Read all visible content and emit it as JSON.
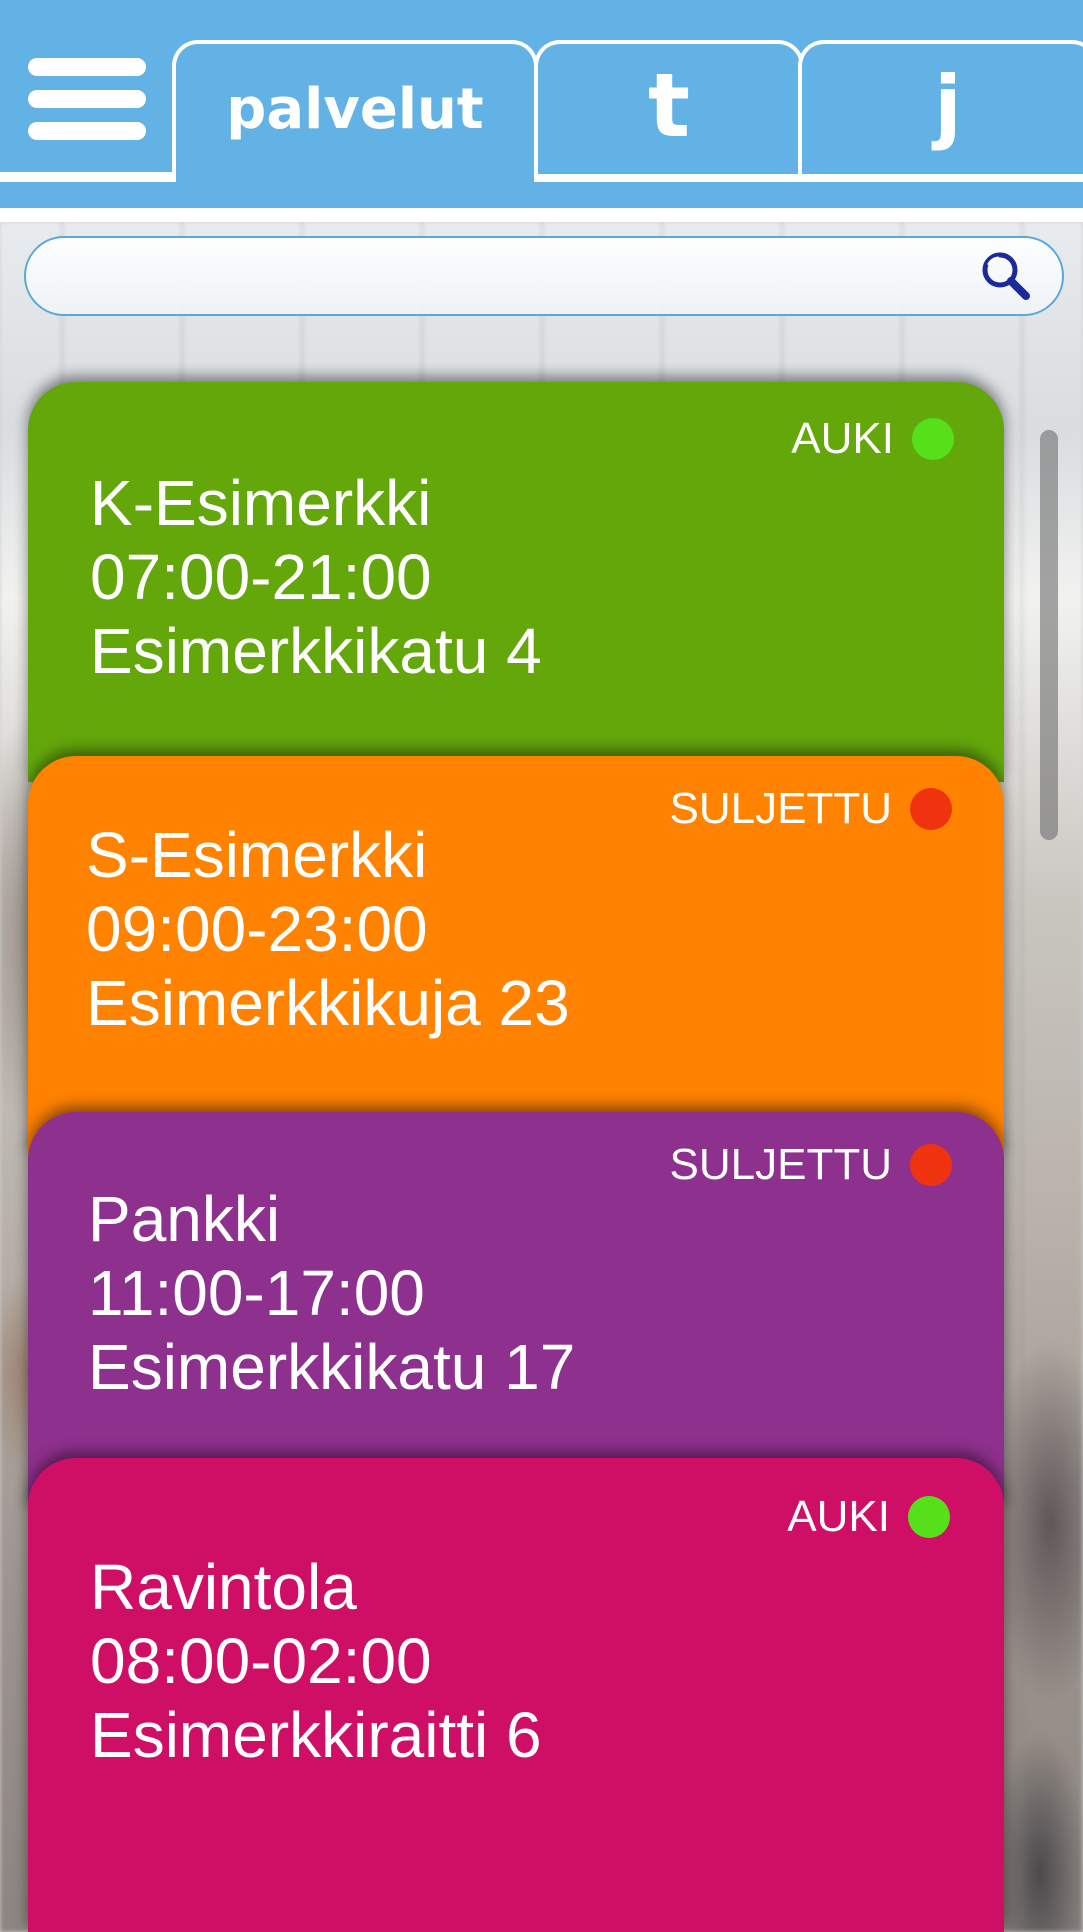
{
  "header": {
    "tabs": [
      {
        "label": "palvelut",
        "active": true
      },
      {
        "label": "t",
        "active": false
      },
      {
        "label": "j",
        "active": false
      }
    ],
    "menu_icon": "hamburger-menu-icon"
  },
  "search": {
    "value": "",
    "placeholder": "",
    "icon": "search-icon"
  },
  "cards": [
    {
      "name": "K-Esimerkki",
      "hours": "07:00-21:00",
      "address": "Esimerkkikatu 4",
      "status": "AUKI",
      "status_color": "#55e01a",
      "color": "#64a70b"
    },
    {
      "name": "S-Esimerkki",
      "hours": "09:00-23:00",
      "address": "Esimerkkikuja 23",
      "status": "SULJETTU",
      "status_color": "#f0330f",
      "color": "#ff8200"
    },
    {
      "name": "Pankki",
      "hours": "11:00-17:00",
      "address": "Esimerkkikatu 17",
      "status": "SULJETTU",
      "status_color": "#f0330f",
      "color": "#8e308d"
    },
    {
      "name": "Ravintola",
      "hours": "08:00-02:00",
      "address": "Esimerkkiraitti 6",
      "status": "AUKI",
      "status_color": "#55e01a",
      "color": "#cf0f66"
    }
  ],
  "colors": {
    "header_blue": "#63b2e6",
    "open": "#55e01a",
    "closed": "#f0330f"
  }
}
